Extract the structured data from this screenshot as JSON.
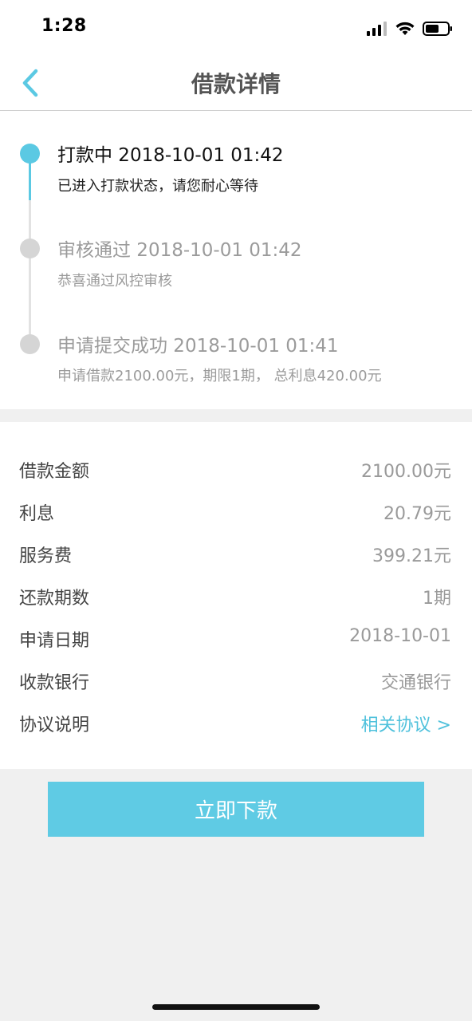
{
  "status_bar": {
    "time": "1:28"
  },
  "nav": {
    "title": "借款详情",
    "back_icon": "chevron-left-icon"
  },
  "timeline": [
    {
      "title": "打款中 2018-10-01 01:42",
      "description": "已进入打款状态，请您耐心等待",
      "active": true
    },
    {
      "title": "审核通过 2018-10-01 01:42",
      "description": "恭喜通过风控审核",
      "active": false
    },
    {
      "title": "申请提交成功 2018-10-01 01:41",
      "description": "申请借款2100.00元，期限1期， 总利息420.00元",
      "active": false
    }
  ],
  "details": [
    {
      "label": "借款金额",
      "value": "2100.00元"
    },
    {
      "label": "利息",
      "value": "20.79元"
    },
    {
      "label": "服务费",
      "value": "399.21元"
    },
    {
      "label": "还款期数",
      "value": "1期"
    },
    {
      "label": "申请日期",
      "value": "2018-10-01"
    },
    {
      "label": "收款银行",
      "value": "交通银行"
    },
    {
      "label": "协议说明",
      "value": "相关协议 >"
    }
  ],
  "action": {
    "button_label": "立即下款"
  },
  "colors": {
    "accent": "#5bc9e3",
    "button": "#5fcbe4",
    "link": "#4fc1dc",
    "inactive": "#d5d5d5"
  }
}
